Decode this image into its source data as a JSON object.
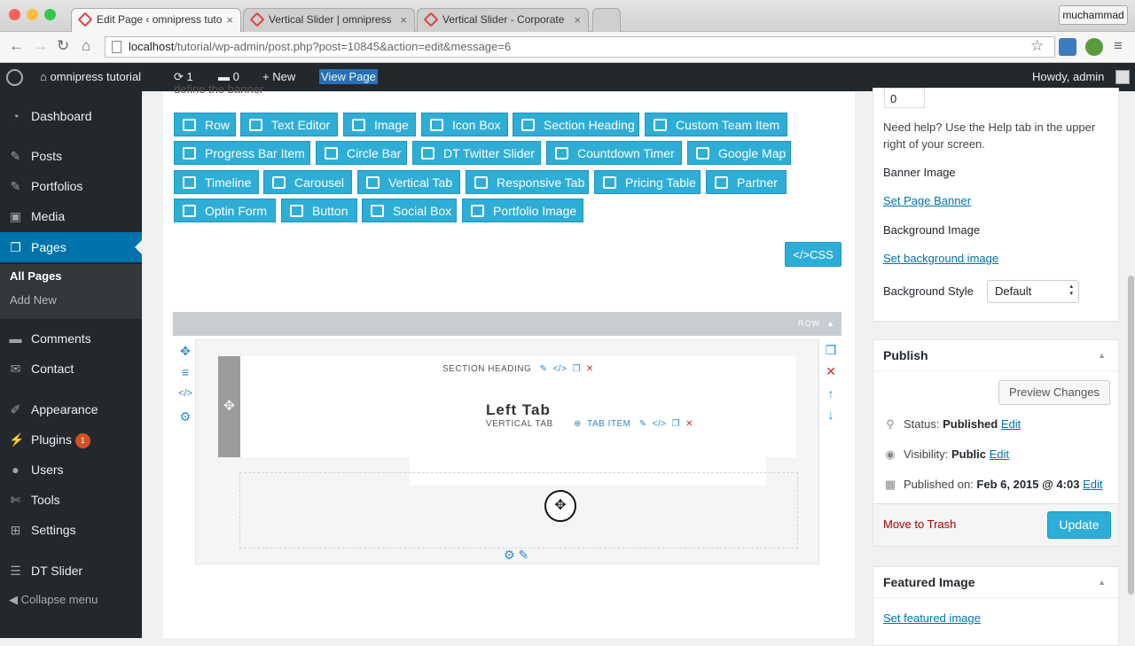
{
  "browser": {
    "tabs": [
      {
        "title": "Edit Page ‹ omnipress tuto"
      },
      {
        "title": "Vertical Slider | omnipress"
      },
      {
        "title": "Vertical Slider - Corporate"
      }
    ],
    "profile": "muchammad",
    "url_host": "localhost",
    "url_path": "/tutorial/wp-admin/post.php?post=10845&action=edit&message=6"
  },
  "adminbar": {
    "site": "omnipress tutorial",
    "updates": "1",
    "comments": "0",
    "new": "New",
    "view": "View Page",
    "howdy": "Howdy, admin"
  },
  "menu": {
    "items": [
      {
        "label": "Dashboard",
        "icon": "dashboard-icon"
      },
      {
        "label": "Posts",
        "icon": "pin-icon"
      },
      {
        "label": "Portfolios",
        "icon": "pin-icon"
      },
      {
        "label": "Media",
        "icon": "media-icon"
      },
      {
        "label": "Pages",
        "icon": "pages-icon"
      },
      {
        "label": "Comments",
        "icon": "comment-icon"
      },
      {
        "label": "Contact",
        "icon": "mail-icon"
      },
      {
        "label": "Appearance",
        "icon": "brush-icon"
      },
      {
        "label": "Plugins",
        "icon": "plug-icon",
        "badge": "1"
      },
      {
        "label": "Users",
        "icon": "user-icon"
      },
      {
        "label": "Tools",
        "icon": "wrench-icon"
      },
      {
        "label": "Settings",
        "icon": "settings-icon"
      },
      {
        "label": "DT Slider",
        "icon": "slider-icon"
      }
    ],
    "submenu": [
      "All Pages",
      "Add New"
    ],
    "collapse": "Collapse menu"
  },
  "editor": {
    "cut_text": "define the banner",
    "elements": [
      "Row",
      "Text Editor",
      "Image",
      "Icon Box",
      "Section Heading",
      "Custom Team Item",
      "Progress Bar Item",
      "Circle Bar",
      "DT Twitter Slider",
      "Countdown Timer",
      "Google Map",
      "Timeline",
      "Carousel",
      "Vertical Tab",
      "Responsive Tab",
      "Pricing Table",
      "Partner",
      "Optin Form",
      "Button",
      "Social Box",
      "Portfolio Image"
    ],
    "css_button": "</>CSS",
    "row_label": "ROW",
    "section_heading_label": "SECTION HEADING",
    "vertical_tab_label": "VERTICAL TAB",
    "tab_item_label": "TAB ITEM",
    "left_tab_text": "Left Tab"
  },
  "sidebar": {
    "number_value": "0",
    "help_text_1": "Need help? Use the Help tab in the upper",
    "help_text_2": "right of your screen.",
    "banner_image_label": "Banner Image",
    "set_page_banner": "Set Page Banner",
    "background_image_label": "Background Image",
    "set_background_image": "Set background image",
    "background_style_label": "Background Style",
    "background_style_value": "Default",
    "publish": {
      "title": "Publish",
      "preview": "Preview Changes",
      "status_label": "Status:",
      "status_value": "Published",
      "visibility_label": "Visibility:",
      "visibility_value": "Public",
      "published_on_label": "Published on:",
      "published_on_value": "Feb 6, 2015 @ 4:03",
      "edit": "Edit",
      "trash": "Move to Trash",
      "update": "Update"
    },
    "featured": {
      "title": "Featured Image",
      "set": "Set featured image"
    }
  },
  "colors": {
    "accent": "#2eaed6",
    "admin_dark": "#23282d",
    "active_menu": "#0073aa"
  }
}
